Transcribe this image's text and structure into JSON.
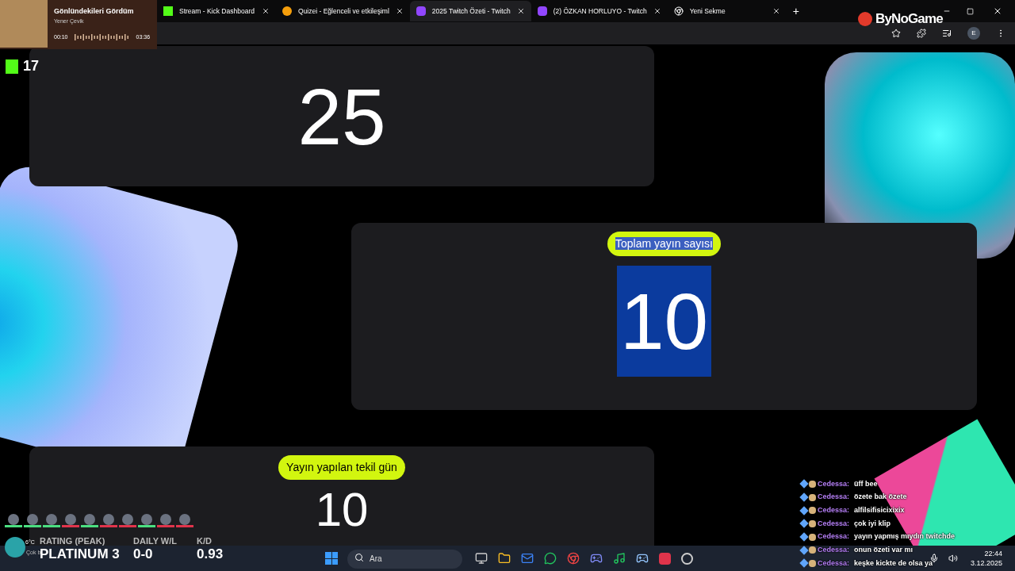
{
  "browser": {
    "tabs": [
      {
        "title": "Stream - Kick Dashboard",
        "kind": "kick",
        "selected": false
      },
      {
        "title": "Quizei - Eğlenceli ve etkileşiml",
        "kind": "quiz",
        "selected": false
      },
      {
        "title": "2025 Twitch Özeti - Twitch",
        "kind": "twitch",
        "selected": true
      },
      {
        "title": "(2) ÖZKAN HORLUYO - Twitch",
        "kind": "twitch",
        "selected": false
      },
      {
        "title": "Yeni Sekme",
        "kind": "chrome",
        "selected": false
      }
    ],
    "new_tab": "+",
    "profile": "E"
  },
  "logo": "ByNoGame",
  "music": {
    "title": "Gönlündekileri Gördüm",
    "artist": "Yener Çevik",
    "elapsed": "00:10",
    "total": "03:36"
  },
  "kick": {
    "count": "17"
  },
  "cards": [
    {
      "value": "25",
      "selected": false
    },
    {
      "label": "Toplam yayın sayısı",
      "value": "10",
      "selected": true
    },
    {
      "label": "Yayın yapılan tekil gün",
      "value": "10",
      "selected": false
    }
  ],
  "game": {
    "players": [
      {
        "color": "#4ade80"
      },
      {
        "color": "#4ade80"
      },
      {
        "color": "#4ade80"
      },
      {
        "color": "#e0344b"
      },
      {
        "color": "#4ade80"
      },
      {
        "color": "#e0344b"
      },
      {
        "color": "#e0344b"
      },
      {
        "color": "#4ade80"
      },
      {
        "color": "#e0344b"
      },
      {
        "color": "#e0344b"
      }
    ],
    "stats": [
      {
        "label": "RATING (PEAK)",
        "value": "PLATINUM 3"
      },
      {
        "label": "DAILY W/L",
        "value": "0-0"
      },
      {
        "label": "K/D",
        "value": "0.93"
      }
    ]
  },
  "weather": {
    "temp": "6°C",
    "condition": "Çok b"
  },
  "chat": [
    {
      "user": "Cedessa:",
      "text": "üff bee"
    },
    {
      "user": "Cedessa:",
      "text": "özete bak özete"
    },
    {
      "user": "Cedessa:",
      "text": "alfilsifisicixixix"
    },
    {
      "user": "Cedessa:",
      "text": "çok iyi klip"
    },
    {
      "user": "Cedessa:",
      "text": "yayın yapmış mıydın twitchde"
    },
    {
      "user": "Cedessa:",
      "text": "onun özeti var mı"
    },
    {
      "user": "Cedessa:",
      "text": "keşke kickte de olsa ya"
    }
  ],
  "taskbar": {
    "search_placeholder": "Ara",
    "time": "22:44",
    "date": "3.12.2025"
  }
}
